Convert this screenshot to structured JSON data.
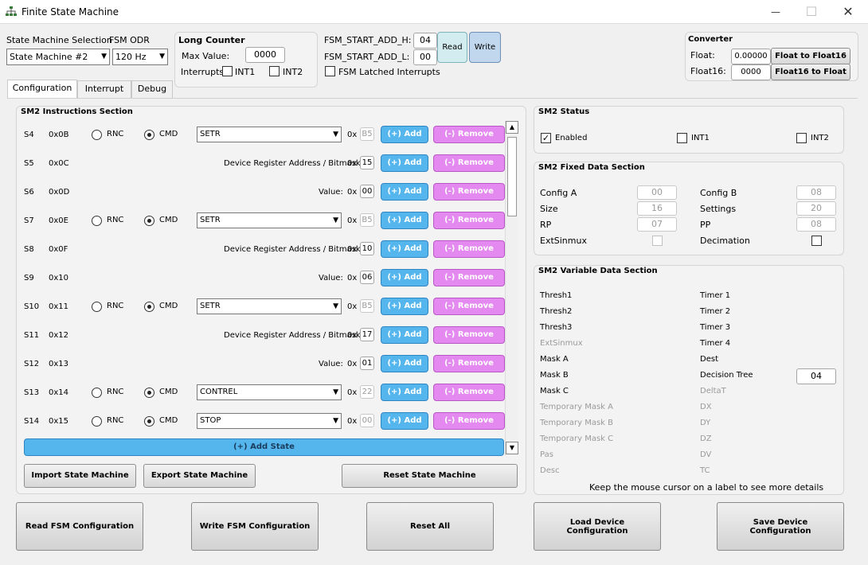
{
  "window": {
    "title": "Finite State Machine",
    "icon": "network-icon",
    "minimize": "—",
    "maximize": "☐",
    "close": "✕"
  },
  "top": {
    "sm_selection_label": "State Machine Selection",
    "sm_selection_value": "State Machine #2",
    "odr_label": "FSM ODR",
    "odr_value": "120 Hz",
    "long_counter": {
      "title": "Long Counter",
      "max_label": "Max Value:",
      "max_value": "0000",
      "interrupts_label": "Interrupts",
      "int1": "INT1",
      "int2": "INT2"
    },
    "fsm_start_h_label": "FSM_START_ADD_H:",
    "fsm_start_h_value": "04",
    "fsm_start_l_label": "FSM_START_ADD_L:",
    "fsm_start_l_value": "00",
    "read_label": "Read",
    "write_label": "Write",
    "latched_label": "FSM Latched Interrupts",
    "converter": {
      "title": "Converter",
      "float_label": "Float:",
      "float_value": "0.00000",
      "float_btn": "Float to Float16",
      "float16_label": "Float16:",
      "float16_value": "0000",
      "float16_btn": "Float16 to Float"
    }
  },
  "tabs": [
    "Configuration",
    "Interrupt",
    "Debug"
  ],
  "instructions": {
    "title": "SM2 Instructions Section",
    "rnc": "RNC",
    "cmd": "CMD",
    "hex_prefix": "0x",
    "add": "(+) Add",
    "remove": "(-) Remove",
    "addr_label": "Device Register Address / Bitmask:",
    "value_label": "Value:",
    "rows": [
      {
        "s": "S4",
        "addr": "0x0B",
        "type": "cmd",
        "combo": "SETR",
        "hex": "B5"
      },
      {
        "s": "S5",
        "addr": "0x0C",
        "type": "reg",
        "hex": "15"
      },
      {
        "s": "S6",
        "addr": "0x0D",
        "type": "val",
        "hex": "00"
      },
      {
        "s": "S7",
        "addr": "0x0E",
        "type": "cmd",
        "combo": "SETR",
        "hex": "B5"
      },
      {
        "s": "S8",
        "addr": "0x0F",
        "type": "reg",
        "hex": "10"
      },
      {
        "s": "S9",
        "addr": "0x10",
        "type": "val",
        "hex": "06"
      },
      {
        "s": "S10",
        "addr": "0x11",
        "type": "cmd",
        "combo": "SETR",
        "hex": "B5"
      },
      {
        "s": "S11",
        "addr": "0x12",
        "type": "reg",
        "hex": "17"
      },
      {
        "s": "S12",
        "addr": "0x13",
        "type": "val",
        "hex": "01"
      },
      {
        "s": "S13",
        "addr": "0x14",
        "type": "cmd",
        "combo": "CONTREL",
        "hex": "22"
      },
      {
        "s": "S14",
        "addr": "0x15",
        "type": "cmd",
        "combo": "STOP",
        "hex": "00"
      }
    ],
    "add_state": "(+) Add State",
    "import": "Import State Machine",
    "export": "Export State Machine",
    "reset": "Reset State Machine"
  },
  "status": {
    "title": "SM2 Status",
    "enabled": "Enabled",
    "int1": "INT1",
    "int2": "INT2"
  },
  "fixed": {
    "title": "SM2 Fixed Data Section",
    "config_a": "Config A",
    "config_a_val": "00",
    "config_b": "Config B",
    "config_b_val": "08",
    "size": "Size",
    "size_val": "16",
    "settings": "Settings",
    "settings_val": "20",
    "rp": "RP",
    "rp_val": "07",
    "pp": "PP",
    "pp_val": "08",
    "extsinmux": "ExtSinmux",
    "decimation": "Decimation"
  },
  "variable": {
    "title": "SM2 Variable Data Section",
    "left": [
      {
        "t": "Thresh1",
        "g": false
      },
      {
        "t": "Thresh2",
        "g": false
      },
      {
        "t": "Thresh3",
        "g": false
      },
      {
        "t": "ExtSinmux",
        "g": true
      },
      {
        "t": "Mask A",
        "g": false
      },
      {
        "t": "Mask B",
        "g": false
      },
      {
        "t": "Mask C",
        "g": false
      },
      {
        "t": "Temporary Mask A",
        "g": true
      },
      {
        "t": "Temporary Mask B",
        "g": true
      },
      {
        "t": "Temporary Mask C",
        "g": true
      },
      {
        "t": "Pas",
        "g": true
      },
      {
        "t": "Desc",
        "g": true
      }
    ],
    "right": [
      {
        "t": "Timer 1",
        "g": false
      },
      {
        "t": "Timer 2",
        "g": false
      },
      {
        "t": "Timer 3",
        "g": false
      },
      {
        "t": "Timer 4",
        "g": false
      },
      {
        "t": "Dest",
        "g": false
      },
      {
        "t": "Decision Tree",
        "g": false
      },
      {
        "t": "DeltaT",
        "g": true
      },
      {
        "t": "DX",
        "g": true
      },
      {
        "t": "DY",
        "g": true
      },
      {
        "t": "DZ",
        "g": true
      },
      {
        "t": "DV",
        "g": true
      },
      {
        "t": "TC",
        "g": true
      }
    ],
    "decision_tree_val": "04",
    "hint": "Keep the mouse cursor on a label to see more details"
  },
  "bottom": {
    "read": "Read FSM Configuration",
    "write": "Write FSM Configuration",
    "reset_all": "Reset All",
    "load": "Load Device Configuration",
    "save": "Save Device Configuration"
  }
}
